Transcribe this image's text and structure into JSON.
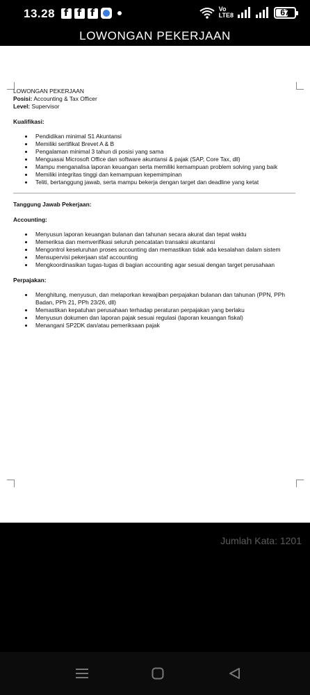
{
  "status_bar": {
    "time": "13.28",
    "volte_line1": "Vo",
    "volte_line2": "LTE8",
    "battery": "67",
    "battery_level": 0.67
  },
  "app_bar": {
    "title": "LOWONGAN PEKERJAAN"
  },
  "document": {
    "heading": "LOWONGAN PEKERJAAN",
    "posisi_label": "Posisi:",
    "posisi_value": " Accounting & Tax Officer",
    "level_label": "Level:",
    "level_value": " Supervisor",
    "kualifikasi_heading": "Kualifikasi:",
    "kualifikasi": [
      "Pendidikan minimal S1 Akuntansi",
      "Memiliki sertifikat Brevet A & B",
      "Pengalaman minimal 3 tahun di posisi yang sama",
      "Menguasai Microsoft Office dan software akuntansi & pajak (SAP, Core Tax, dll)",
      "Mampu menganalisa laporan keuangan serta memiliki kemampuan problem solving yang baik",
      "Memiliki integritas tinggi dan kemampuan kepemimpinan",
      "Teliti, bertanggung jawab, serta mampu bekerja dengan target dan deadline yang ketat"
    ],
    "tanggung_jawab_heading": "Tanggung Jawab Pekerjaan:",
    "accounting_heading": "Accounting:",
    "accounting": [
      "Menyusun laporan keuangan bulanan dan tahunan secara akurat dan tepat waktu",
      "Memeriksa dan memverifikasi seluruh pencatatan transaksi akuntansi",
      "Mengontrol keseluruhan proses accounting dan memastikan tidak ada kesalahan dalam sistem",
      "Mensupervisi pekerjaan staf accounting",
      "Mengkoordinasikan tugas-tugas di bagian accounting agar sesuai dengan target perusahaan"
    ],
    "perpajakan_heading": "Perpajakan:",
    "perpajakan": [
      "Menghitung, menyusun, dan melaporkan kewajiban perpajakan bulanan dan tahunan (PPN, PPh Badan, PPh 21, PPh 23/26, dll)",
      "Memastikan kepatuhan perusahaan terhadap peraturan perpajakan yang berlaku",
      "Menyusun dokumen dan laporan pajak sesuai regulasi (laporan keuangan fiskal)",
      "Menangani SP2DK dan/atau pemeriksaan pajak"
    ]
  },
  "word_count": "Jumlah Kata: 1201",
  "icons": {
    "facebook": "facebook-icon",
    "app": "app-icon",
    "wifi": "wifi-icon",
    "signal": "signal-icon",
    "battery": "battery-icon",
    "menu": "recent-apps-icon",
    "home": "home-icon",
    "back": "back-icon"
  }
}
